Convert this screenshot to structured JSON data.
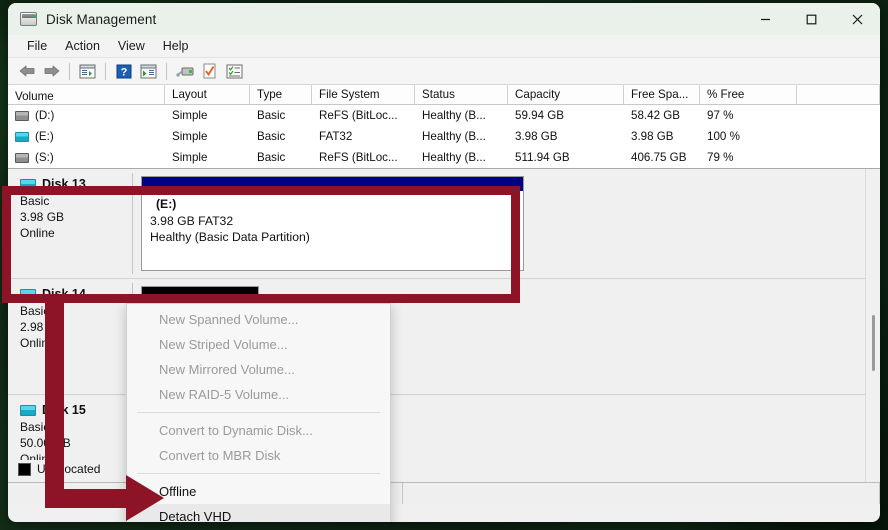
{
  "window": {
    "title": "Disk Management",
    "app_icon": "disk-drive-icon",
    "controls": {
      "minimize": "minimize-icon",
      "maximize": "maximize-icon",
      "close": "close-icon"
    }
  },
  "menubar": {
    "items": [
      "File",
      "Action",
      "View",
      "Help"
    ]
  },
  "toolbar": {
    "buttons": [
      {
        "name": "back-button",
        "icon": "left-arrow-icon"
      },
      {
        "name": "forward-button",
        "icon": "right-arrow-icon"
      },
      {
        "name": "show-hide-console-tree-button",
        "icon": "console-tree-icon"
      },
      {
        "name": "help-button",
        "icon": "question-mark-icon"
      },
      {
        "name": "show-hide-action-pane-button",
        "icon": "action-pane-icon"
      },
      {
        "name": "rescan-disks-button",
        "icon": "disk-drive-icon"
      },
      {
        "name": "properties-button",
        "icon": "checked-document-icon"
      },
      {
        "name": "all-tasks-button",
        "icon": "task-list-icon"
      }
    ]
  },
  "volume_list": {
    "columns": [
      "Volume",
      "Layout",
      "Type",
      "File System",
      "Status",
      "Capacity",
      "Free Spa...",
      "% Free",
      ""
    ],
    "rows": [
      {
        "icon": "drive-icon",
        "volume": "(D:)",
        "layout": "Simple",
        "type": "Basic",
        "file_system": "ReFS (BitLoc...",
        "status": "Healthy (B...",
        "capacity": "59.94 GB",
        "free_space": "58.42 GB",
        "percent_free": "97 %"
      },
      {
        "icon": "vhd-drive-icon",
        "volume": "(E:)",
        "layout": "Simple",
        "type": "Basic",
        "file_system": "FAT32",
        "status": "Healthy (B...",
        "capacity": "3.98 GB",
        "free_space": "3.98 GB",
        "percent_free": "100 %"
      },
      {
        "icon": "drive-icon",
        "volume": "(S:)",
        "layout": "Simple",
        "type": "Basic",
        "file_system": "ReFS (BitLoc...",
        "status": "Healthy (B...",
        "capacity": "511.94 GB",
        "free_space": "406.75 GB",
        "percent_free": "79 %"
      }
    ]
  },
  "disks": [
    {
      "name": "Disk 13",
      "type": "Basic",
      "size": "3.98 GB",
      "state": "Online",
      "icon": "vhd-drive-icon",
      "partition": {
        "label": "(E:)",
        "size_fs": "3.98 GB FAT32",
        "status": "Healthy (Basic Data Partition)",
        "bar_color": "#000080"
      }
    },
    {
      "name": "Disk 14",
      "type": "Basic",
      "size": "2.98 GB",
      "state": "Online",
      "icon": "vhd-drive-icon",
      "partition": {
        "label": "",
        "size_fs": "",
        "status": "",
        "bar_color": "#000000"
      }
    },
    {
      "name": "Disk 15",
      "type": "Basic",
      "size": "50.00 GB",
      "state": "Online",
      "icon": "vhd-drive-icon",
      "partition": {
        "label": "",
        "size_fs": "",
        "status": "",
        "bar_color": "#000000"
      }
    }
  ],
  "legend": {
    "swatch_color": "#000000",
    "label": "Unallocated"
  },
  "context_menu": {
    "items": [
      {
        "label": "New Spanned Volume...",
        "enabled": false,
        "hovered": false
      },
      {
        "label": "New Striped Volume...",
        "enabled": false,
        "hovered": false
      },
      {
        "label": "New Mirrored Volume...",
        "enabled": false,
        "hovered": false
      },
      {
        "label": "New RAID-5 Volume...",
        "enabled": false,
        "hovered": false
      },
      {
        "separator": true
      },
      {
        "label": "Convert to Dynamic Disk...",
        "enabled": false,
        "hovered": false
      },
      {
        "label": "Convert to MBR Disk",
        "enabled": false,
        "hovered": false
      },
      {
        "separator": true
      },
      {
        "label": "Offline",
        "enabled": true,
        "hovered": false
      },
      {
        "label": "Detach VHD",
        "enabled": true,
        "hovered": true
      }
    ]
  },
  "annotation": {
    "color": "#8c1426",
    "highlight_target": "Disk 13",
    "arrow_target": "Detach VHD"
  }
}
